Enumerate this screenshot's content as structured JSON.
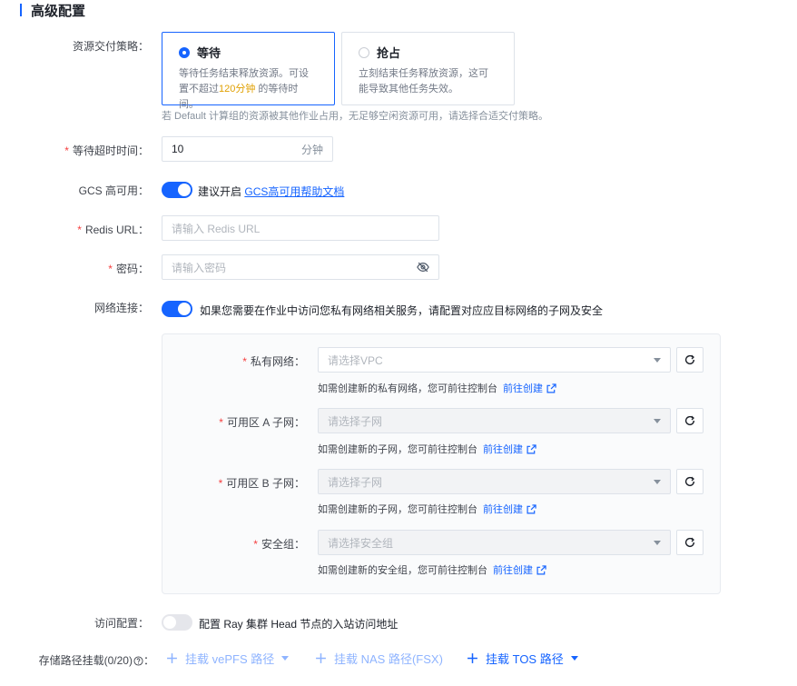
{
  "section": {
    "title": "高级配置"
  },
  "delivery": {
    "label": "资源交付策略",
    "options": [
      {
        "title": "等待",
        "desc_prefix": "等待任务结束释放资源。可设置不超过",
        "desc_highlight": "120分钟",
        "desc_suffix": " 的等待时间。",
        "selected": true
      },
      {
        "title": "抢占",
        "desc": "立刻结束任务释放资源，这可能导致其他任务失效。",
        "selected": false
      }
    ],
    "hint": "若 Default 计算组的资源被其他作业占用，无足够空闲资源可用，请选择合适交付策略。"
  },
  "timeout": {
    "label": "等待超时时间",
    "value": "10",
    "unit": "分钟"
  },
  "gcs": {
    "label": "GCS 高可用",
    "enabled": true,
    "text": "建议开启",
    "link": "GCS高可用帮助文档"
  },
  "redis": {
    "label": "Redis URL",
    "placeholder": "请输入 Redis URL"
  },
  "password": {
    "label": "密码",
    "placeholder": "请输入密码"
  },
  "network": {
    "label": "网络连接",
    "enabled": true,
    "text": "如果您需要在作业中访问您私有网络相关服务，请配置对应应目标网络的子网及安全",
    "fields": [
      {
        "label": "私有网络",
        "placeholder": "请选择VPC",
        "hint": "如需创建新的私有网络，您可前往控制台",
        "go": "前往创建",
        "disabled": false
      },
      {
        "label": "可用区 A 子网",
        "placeholder": "请选择子网",
        "hint": "如需创建新的子网，您可前往控制台",
        "go": "前往创建",
        "disabled": true
      },
      {
        "label": "可用区 B 子网",
        "placeholder": "请选择子网",
        "hint": "如需创建新的子网，您可前往控制台",
        "go": "前往创建",
        "disabled": true
      },
      {
        "label": "安全组",
        "placeholder": "请选择安全组",
        "hint": "如需创建新的安全组，您可前往控制台",
        "go": "前往创建",
        "disabled": true
      }
    ]
  },
  "access": {
    "label": "访问配置",
    "enabled": false,
    "text": "配置 Ray 集群 Head 节点的入站访问地址"
  },
  "storage": {
    "label": "存储路径挂载(0/20)",
    "actions": [
      {
        "label": "挂载 vePFS 路径"
      },
      {
        "label": "挂载 NAS 路径(FSX)"
      },
      {
        "label": "挂载 TOS 路径"
      }
    ]
  },
  "colors": {
    "primary": "#1664ff",
    "required": "#f53f3f",
    "highlight": "#e0a000"
  }
}
